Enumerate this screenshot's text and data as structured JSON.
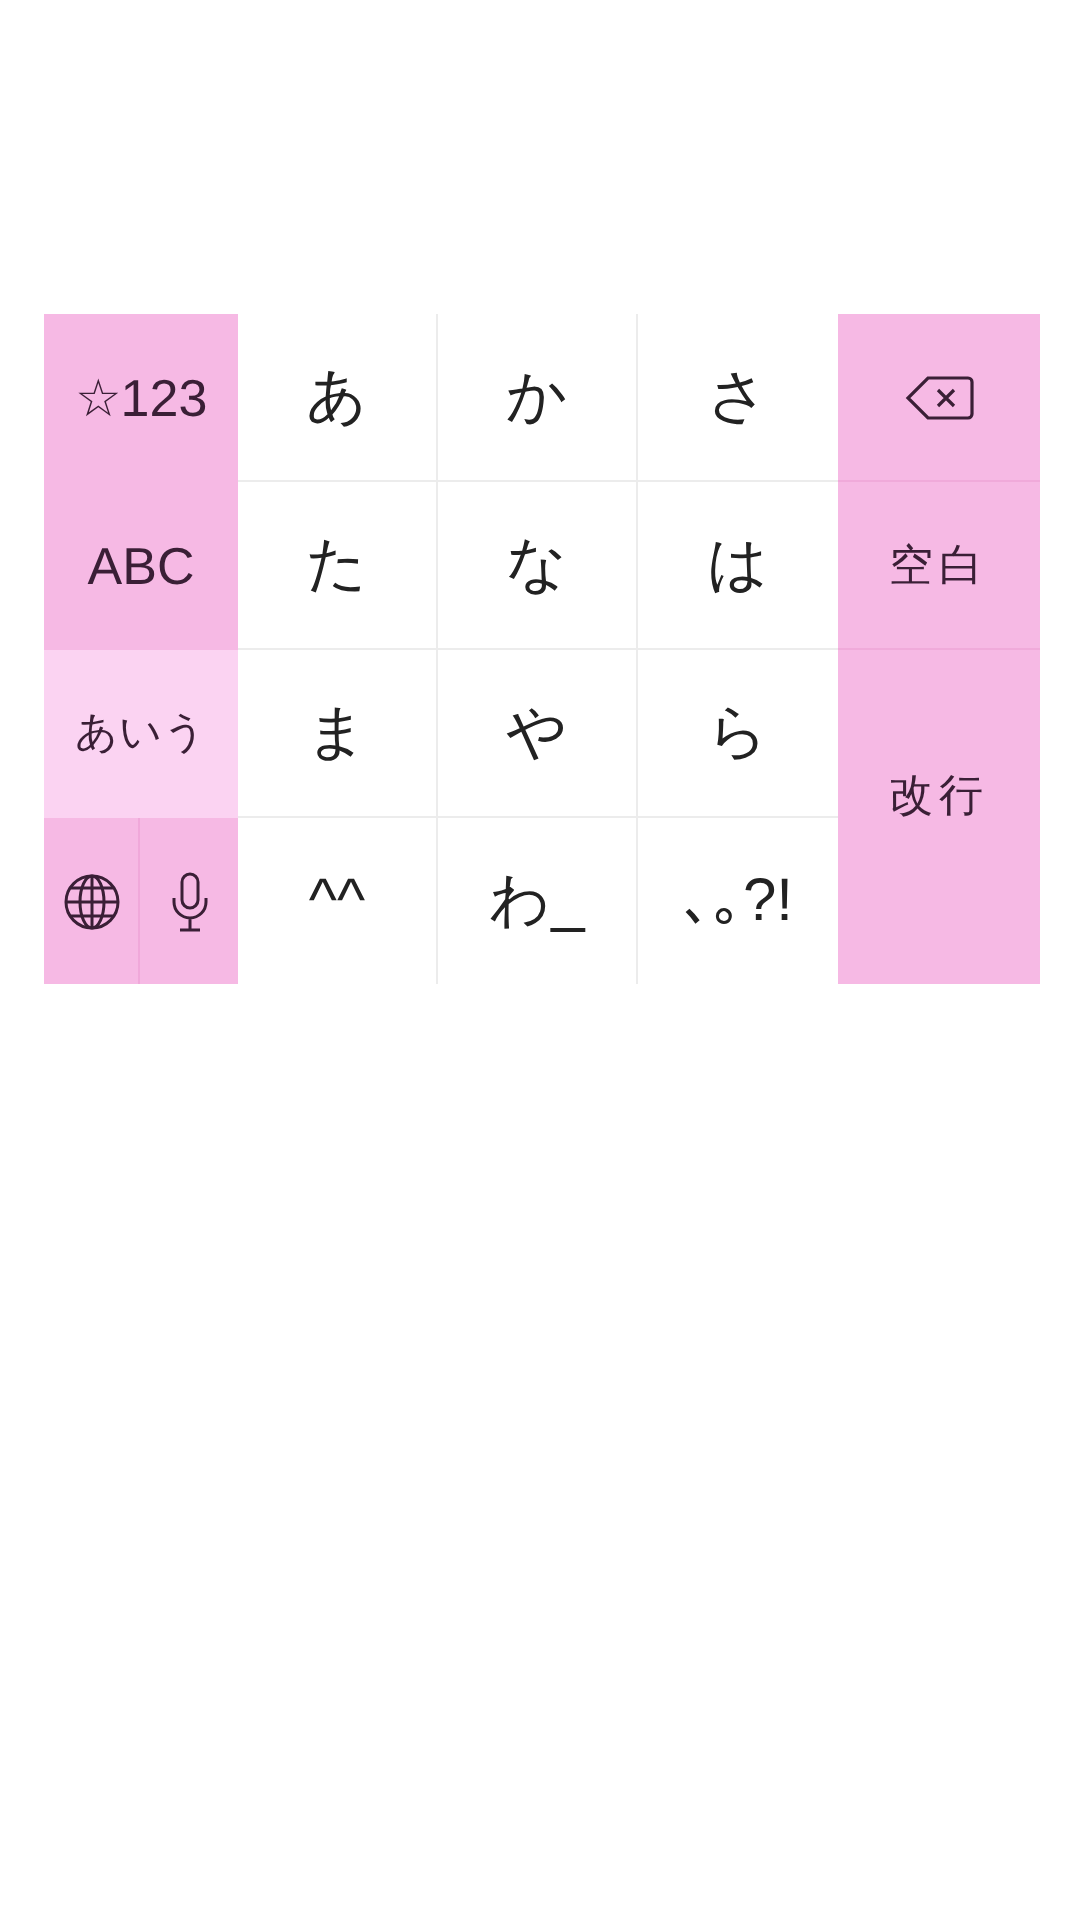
{
  "keyboard": {
    "mode_keys": [
      {
        "label": "☆123",
        "selected": false
      },
      {
        "label": "ABC",
        "selected": false
      },
      {
        "label": "あいう",
        "selected": true
      }
    ],
    "kana_rows": [
      [
        "あ",
        "か",
        "さ"
      ],
      [
        "た",
        "な",
        "は"
      ],
      [
        "ま",
        "や",
        "ら"
      ],
      [
        "^^",
        "わ_",
        "､｡?!"
      ]
    ],
    "space_key": "空白",
    "return_key": "改行"
  }
}
